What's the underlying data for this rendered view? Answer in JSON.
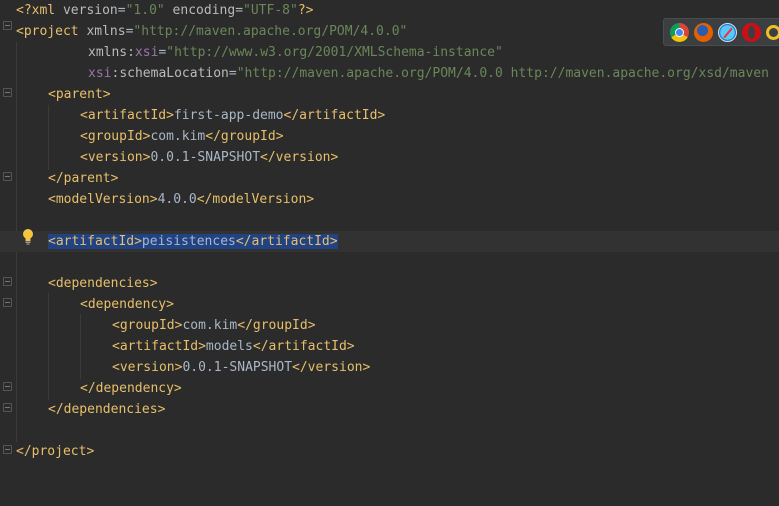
{
  "editor": {
    "lines": [
      {
        "segments": [
          {
            "c": "tag",
            "t": "<?xml "
          },
          {
            "c": "attr",
            "t": "version"
          },
          {
            "c": "plain",
            "t": "="
          },
          {
            "c": "str",
            "t": "\"1.0\""
          },
          {
            "c": "attr",
            "t": " encoding"
          },
          {
            "c": "plain",
            "t": "="
          },
          {
            "c": "str",
            "t": "\"UTF-8\""
          },
          {
            "c": "tag",
            "t": "?>"
          }
        ]
      },
      {
        "segments": [
          {
            "c": "tag",
            "t": "<project "
          },
          {
            "c": "attr",
            "t": "xmlns"
          },
          {
            "c": "plain",
            "t": "="
          },
          {
            "c": "str",
            "t": "\"http://maven.apache.org/POM/4.0.0\""
          }
        ]
      },
      {
        "segments": [
          {
            "c": "attr",
            "t": "xmlns"
          },
          {
            "c": "plain",
            "t": ":"
          },
          {
            "c": "ns",
            "t": "xsi"
          },
          {
            "c": "plain",
            "t": "="
          },
          {
            "c": "str",
            "t": "\"http://www.w3.org/2001/XMLSchema-instance\""
          }
        ]
      },
      {
        "segments": [
          {
            "c": "ns",
            "t": "xsi"
          },
          {
            "c": "plain",
            "t": ":"
          },
          {
            "c": "attr",
            "t": "schemaLocation"
          },
          {
            "c": "plain",
            "t": "="
          },
          {
            "c": "str",
            "t": "\"http://maven.apache.org/POM/4.0.0 http://maven.apache.org/xsd/maven"
          }
        ]
      },
      {
        "segments": [
          {
            "c": "tag",
            "t": "<parent>"
          }
        ]
      },
      {
        "segments": [
          {
            "c": "tag",
            "t": "<artifactId>"
          },
          {
            "c": "plain",
            "t": "first-app-demo"
          },
          {
            "c": "tag",
            "t": "</artifactId>"
          }
        ]
      },
      {
        "segments": [
          {
            "c": "tag",
            "t": "<groupId>"
          },
          {
            "c": "plain",
            "t": "com.kim"
          },
          {
            "c": "tag",
            "t": "</groupId>"
          }
        ]
      },
      {
        "segments": [
          {
            "c": "tag",
            "t": "<version>"
          },
          {
            "c": "plain",
            "t": "0.0.1-SNAPSHOT"
          },
          {
            "c": "tag",
            "t": "</version>"
          }
        ]
      },
      {
        "segments": [
          {
            "c": "tag",
            "t": "</parent>"
          }
        ]
      },
      {
        "segments": [
          {
            "c": "tag",
            "t": "<modelVersion>"
          },
          {
            "c": "plain",
            "t": "4.0.0"
          },
          {
            "c": "tag",
            "t": "</modelVersion>"
          }
        ]
      },
      {
        "segments": []
      },
      {
        "segments": [
          {
            "c": "tag",
            "t": "<artifactId>",
            "sel": true
          },
          {
            "c": "plain",
            "t": "peisistences",
            "sel": true
          },
          {
            "c": "tag",
            "t": "</artifactId>",
            "sel": true
          }
        ]
      },
      {
        "segments": []
      },
      {
        "segments": [
          {
            "c": "tag",
            "t": "<dependencies>"
          }
        ]
      },
      {
        "segments": [
          {
            "c": "tag",
            "t": "<dependency>"
          }
        ]
      },
      {
        "segments": [
          {
            "c": "tag",
            "t": "<groupId>"
          },
          {
            "c": "plain",
            "t": "com.kim"
          },
          {
            "c": "tag",
            "t": "</groupId>"
          }
        ]
      },
      {
        "segments": [
          {
            "c": "tag",
            "t": "<artifactId>"
          },
          {
            "c": "plain",
            "t": "models"
          },
          {
            "c": "tag",
            "t": "</artifactId>"
          }
        ]
      },
      {
        "segments": [
          {
            "c": "tag",
            "t": "<version>"
          },
          {
            "c": "plain",
            "t": "0.0.1-SNAPSHOT"
          },
          {
            "c": "tag",
            "t": "</version>"
          }
        ]
      },
      {
        "segments": [
          {
            "c": "tag",
            "t": "</dependency>"
          }
        ]
      },
      {
        "segments": [
          {
            "c": "tag",
            "t": "</dependencies>"
          }
        ]
      },
      {
        "segments": []
      },
      {
        "segments": [
          {
            "c": "tag",
            "t": "</project>"
          }
        ]
      }
    ]
  },
  "colors": {
    "background": "#2b2b2b",
    "tag": "#e8bf6a",
    "attribute": "#bababa",
    "namespace": "#9876aa",
    "string": "#6a8759",
    "text": "#a9b7c6",
    "selection": "#214283",
    "current_line": "#323232"
  },
  "browser_icons": [
    "chrome-icon",
    "firefox-icon",
    "safari-icon",
    "opera-icon",
    "ie-icon"
  ]
}
